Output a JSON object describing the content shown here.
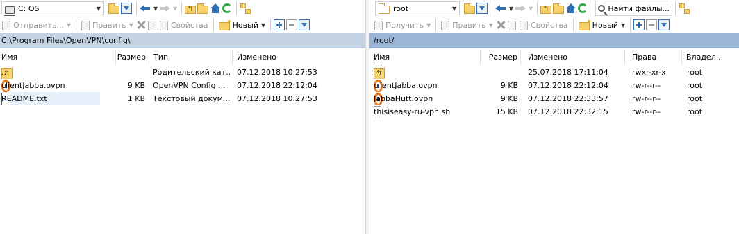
{
  "left": {
    "drive": "C: OS",
    "toolbar2": {
      "send": "Отправить...",
      "edit": "Править",
      "properties": "Свойства",
      "new": "Новый"
    },
    "path": "C:\\Program Files\\OpenVPN\\config\\",
    "columns": {
      "name": "Имя",
      "size": "Размер",
      "type": "Тип",
      "modified": "Изменено"
    },
    "files": [
      {
        "name": "..",
        "size": "",
        "type": "Родительский кат...",
        "modified": "07.12.2018  10:27:53",
        "icon": "parent-folder-icon"
      },
      {
        "name": "clientJabba.ovpn",
        "size": "9 KB",
        "type": "OpenVPN Config ...",
        "modified": "07.12.2018  22:12:04",
        "icon": "openvpn-file-icon"
      },
      {
        "name": "README.txt",
        "size": "1 KB",
        "type": "Текстовый докум...",
        "modified": "07.12.2018  10:27:53",
        "icon": "text-file-icon"
      }
    ]
  },
  "right": {
    "drive": "root",
    "find_files": "Найти файлы...",
    "toolbar2": {
      "receive": "Получить",
      "edit": "Править",
      "properties": "Свойства",
      "new": "Новый"
    },
    "path": "/root/",
    "columns": {
      "name": "Имя",
      "size": "Размер",
      "modified": "Изменено",
      "rights": "Права",
      "owner": "Владел..."
    },
    "files": [
      {
        "name": "..",
        "size": "",
        "modified": "25.07.2018 17:11:04",
        "rights": "rwxr-xr-x",
        "owner": "root",
        "icon": "parent-folder-icon"
      },
      {
        "name": "clientJabba.ovpn",
        "size": "9 KB",
        "modified": "07.12.2018 22:12:04",
        "rights": "rw-r--r--",
        "owner": "root",
        "icon": "openvpn-file-icon"
      },
      {
        "name": "JabbaHutt.ovpn",
        "size": "9 KB",
        "modified": "07.12.2018 22:33:57",
        "rights": "rw-r--r--",
        "owner": "root",
        "icon": "openvpn-file-icon"
      },
      {
        "name": "thisiseasy-ru-vpn.sh",
        "size": "15 KB",
        "modified": "07.12.2018 22:32:15",
        "rights": "rw-r--r--",
        "owner": "root",
        "icon": "shell-script-icon"
      }
    ]
  }
}
